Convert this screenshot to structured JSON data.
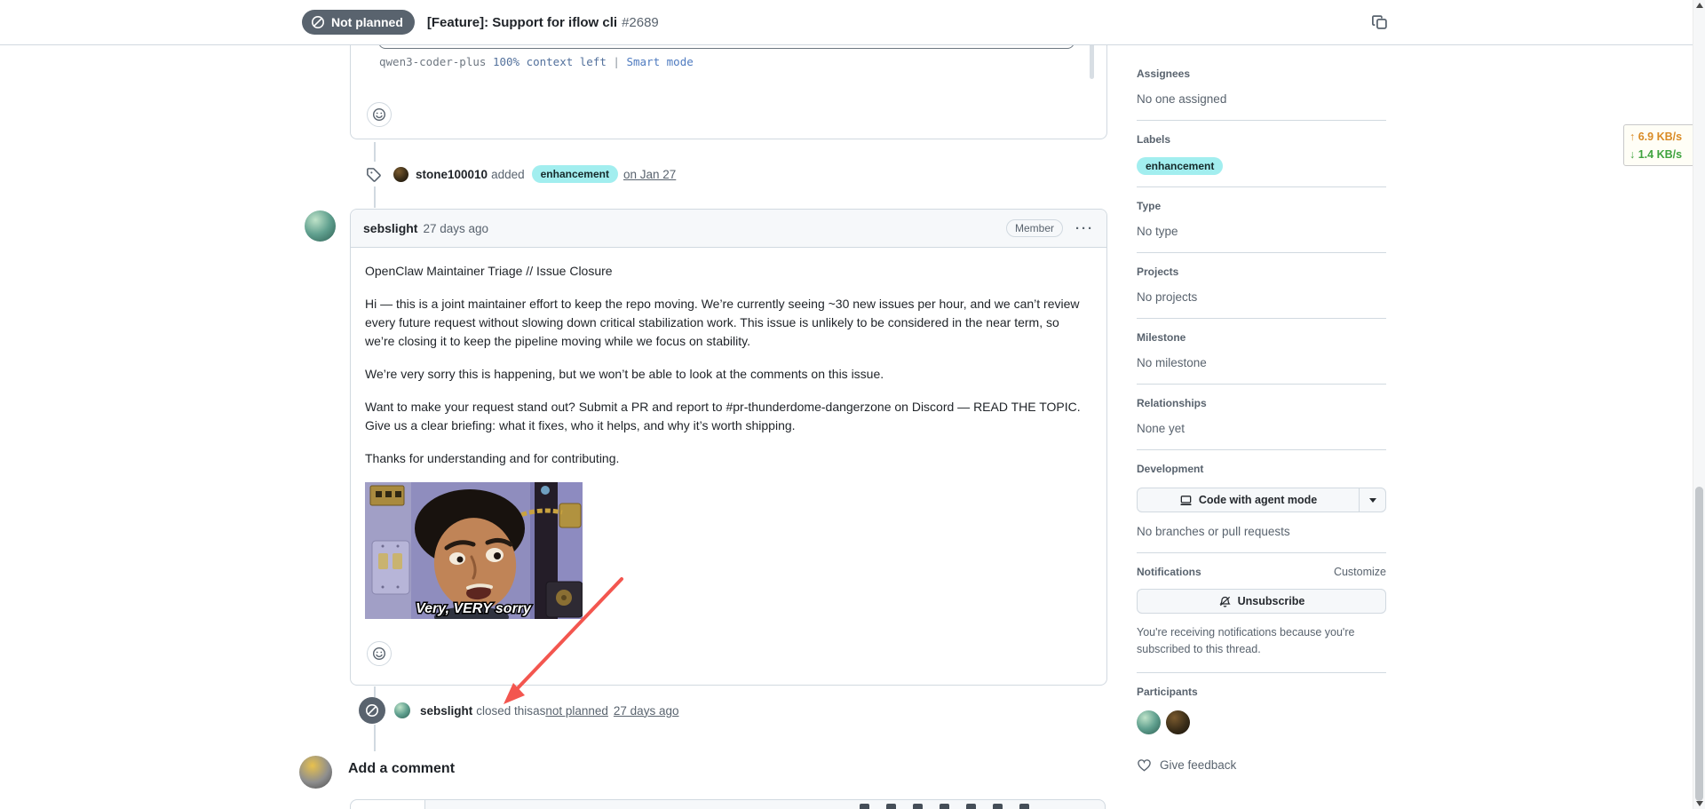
{
  "header": {
    "status": "Not planned",
    "title": "[Feature]: Support for iflow cli",
    "number": "#2689"
  },
  "code_preview": {
    "model": "qwen3-coder-plus",
    "context": "100% context left",
    "sep": "|",
    "mode": "Smart mode"
  },
  "label_event": {
    "actor": "stone100010",
    "action": "added",
    "label": "enhancement",
    "date": "on Jan 27"
  },
  "comment": {
    "author": "sebslight",
    "time": "27 days ago",
    "badge": "Member",
    "menu": "···",
    "paragraphs": [
      "OpenClaw Maintainer Triage // Issue Closure",
      "Hi — this is a joint maintainer effort to keep the repo moving. We’re currently seeing ~30 new issues per hour, and we can’t review every future request without slowing down critical stabilization work. This issue is unlikely to be considered in the near term, so we’re closing it to keep the pipeline moving while we focus on stability.",
      "We’re very sorry this is happening, but we won’t be able to look at the comments on this issue.",
      "Want to make your request stand out? Submit a PR and report to #pr-thunderdome-dangerzone on Discord — READ THE TOPIC. Give us a clear briefing: what it fixes, who it helps, and why it’s worth shipping.",
      "Thanks for understanding and for contributing."
    ],
    "gif_caption": "Very, VERY sorry"
  },
  "closed_event": {
    "actor": "sebslight",
    "action": "closed this",
    "as_word": "as",
    "state": "not planned",
    "time": "27 days ago"
  },
  "add_comment": {
    "heading": "Add a comment"
  },
  "sidebar": {
    "assignees": {
      "title": "Assignees",
      "value": "No one assigned"
    },
    "labels": {
      "title": "Labels",
      "value": "enhancement"
    },
    "type": {
      "title": "Type",
      "value": "No type"
    },
    "projects": {
      "title": "Projects",
      "value": "No projects"
    },
    "milestone": {
      "title": "Milestone",
      "value": "No milestone"
    },
    "relationships": {
      "title": "Relationships",
      "value": "None yet"
    },
    "development": {
      "title": "Development",
      "button": "Code with agent mode",
      "value": "No branches or pull requests"
    },
    "notifications": {
      "title": "Notifications",
      "customize": "Customize",
      "button": "Unsubscribe",
      "note": "You're receiving notifications because you're subscribed to this thread."
    },
    "participants": {
      "title": "Participants"
    },
    "feedback": "Give feedback"
  },
  "netspeed": {
    "up_arrow": "↑",
    "up": "6.9 KB/s",
    "down_arrow": "↓",
    "down": "1.4 KB/s"
  },
  "colors": {
    "status_gray": "#59636e",
    "label_bg": "#a2eeef",
    "arrow_red": "#f3564f",
    "net_up": "#d98b26",
    "net_down": "#3fa33f",
    "link": "#0969da"
  }
}
